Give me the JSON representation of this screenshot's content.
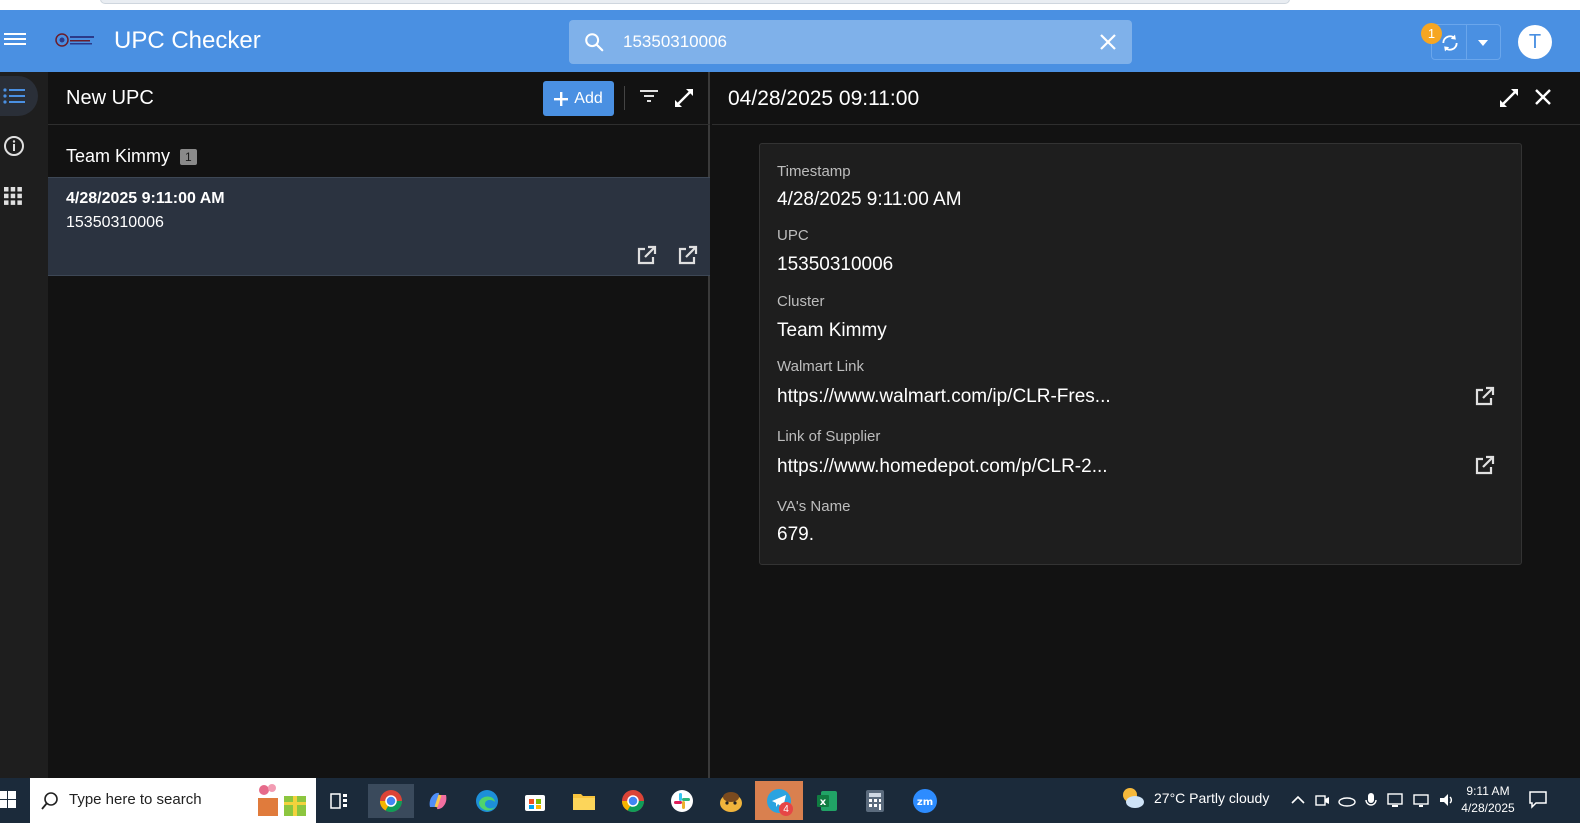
{
  "header": {
    "app_title": "UPC Checker",
    "search_value": "15350310006",
    "notification_count": "1",
    "avatar_initial": "T",
    "accent_color": "#4a90e2"
  },
  "rail": {
    "items": [
      "list-icon",
      "info-icon",
      "apps-grid-icon"
    ]
  },
  "list_panel": {
    "title": "New UPC",
    "add_label": "Add",
    "group": {
      "name": "Team Kimmy",
      "count": "1"
    },
    "items": [
      {
        "timestamp": "4/28/2025 9:11:00 AM",
        "upc": "15350310006"
      }
    ]
  },
  "detail_panel": {
    "title": "04/28/2025 09:11:00",
    "fields": [
      {
        "label": "Timestamp",
        "value": "4/28/2025 9:11:00 AM"
      },
      {
        "label": "UPC",
        "value": "15350310006"
      },
      {
        "label": "Cluster",
        "value": "Team Kimmy"
      },
      {
        "label": "Walmart Link",
        "value": "https://www.walmart.com/ip/CLR-Fres..."
      },
      {
        "label": "Link of Supplier",
        "value": "https://www.homedepot.com/p/CLR-2..."
      },
      {
        "label": "VA's Name",
        "value": "679."
      }
    ]
  },
  "taskbar": {
    "search_placeholder": "Type here to search",
    "weather": "27°C  Partly cloudy",
    "time": "9:11 AM",
    "date": "4/28/2025",
    "telegram_badge": "4"
  }
}
